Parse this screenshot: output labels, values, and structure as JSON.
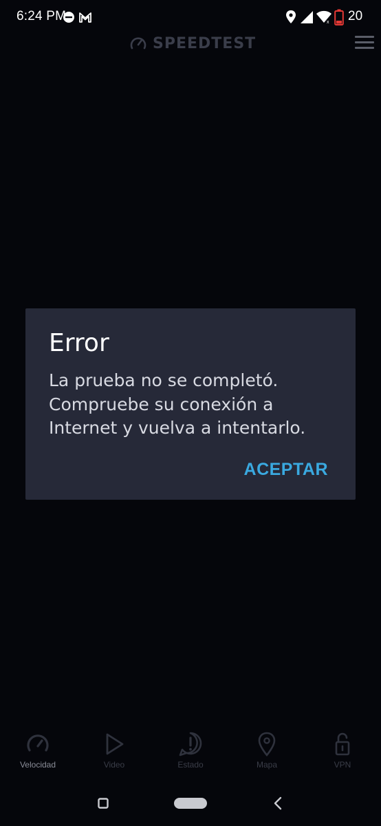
{
  "status_bar": {
    "time": "6:24 PM",
    "battery_level": "20",
    "icons": [
      "do-not-disturb-icon",
      "gmail-icon",
      "location-icon",
      "signal-icon",
      "wifi-icon",
      "battery-icon"
    ],
    "battery_color": "#e53935"
  },
  "header": {
    "brand": "SPEEDTEST",
    "menu_icon": "hamburger-menu-icon"
  },
  "dialog": {
    "title": "Error",
    "message": "La prueba no se completó. Compruebe su conexión a Internet y vuelva a intentarlo.",
    "button": "ACEPTAR",
    "background": "#262938",
    "accent": "#3aa9e0"
  },
  "bottom_nav": {
    "items": [
      {
        "label": "Velocidad",
        "icon": "speedometer-icon",
        "active": true
      },
      {
        "label": "Video",
        "icon": "play-icon",
        "active": false
      },
      {
        "label": "Estado",
        "icon": "alert-bubble-icon",
        "active": false
      },
      {
        "label": "Mapa",
        "icon": "map-pin-icon",
        "active": false
      },
      {
        "label": "VPN",
        "icon": "unlock-icon",
        "active": false
      }
    ]
  },
  "system_nav": {
    "icons": [
      "recents-icon",
      "home-pill-icon",
      "back-icon"
    ]
  }
}
